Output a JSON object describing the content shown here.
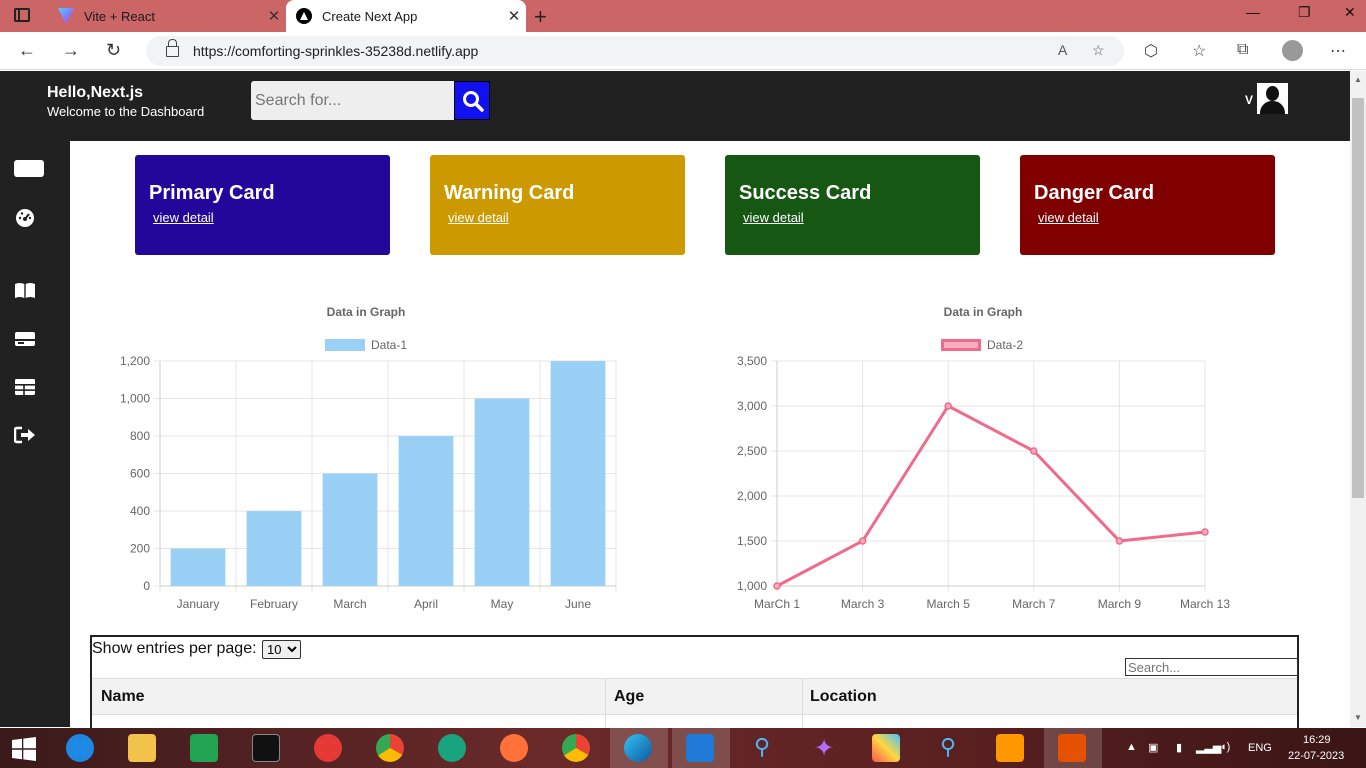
{
  "browser": {
    "tabs": [
      {
        "title": "Vite + React",
        "active": false
      },
      {
        "title": "Create Next App",
        "active": true
      }
    ],
    "url": "https://comforting-sprinkles-35238d.netlify.app"
  },
  "header": {
    "title": "Hello,Next.js",
    "subtitle": "Welcome to the Dashboard",
    "search_placeholder": "Search for...",
    "user_initial": "V"
  },
  "sidebar": {
    "icons": [
      "id-card-icon",
      "dashboard-gauge-icon",
      "book-icon",
      "card-icon",
      "table-icon",
      "logout-icon"
    ]
  },
  "cards": [
    {
      "title": "Primary Card",
      "link": "view detail",
      "color": "#22089a"
    },
    {
      "title": "Warning Card",
      "link": "view detail",
      "color": "#cc9900"
    },
    {
      "title": "Success Card",
      "link": "view detail",
      "color": "#165713"
    },
    {
      "title": "Danger Card",
      "link": "view detail",
      "color": "#800000"
    }
  ],
  "chart_data": [
    {
      "type": "bar",
      "title": "Data in Graph",
      "legend": "Data-1",
      "categories": [
        "January",
        "February",
        "March",
        "April",
        "May",
        "June"
      ],
      "values": [
        200,
        400,
        600,
        800,
        1000,
        1200
      ],
      "ylim": [
        0,
        1200
      ],
      "yticks": [
        "0",
        "200",
        "400",
        "600",
        "800",
        "1,000",
        "1,200"
      ],
      "color": "#9ad0f5"
    },
    {
      "type": "line",
      "title": "Data in Graph",
      "legend": "Data-2",
      "categories": [
        "MarCh 1",
        "March 3",
        "March 5",
        "March 7",
        "March 9",
        "March 13"
      ],
      "values": [
        1000,
        1500,
        3000,
        2500,
        1500,
        1600
      ],
      "ylim": [
        1000,
        3500
      ],
      "yticks": [
        "1,000",
        "1,500",
        "2,000",
        "2,500",
        "3,000",
        "3,500"
      ],
      "color": "#f06a8a"
    }
  ],
  "table": {
    "show_label": "Show entries per page:",
    "entries_value": "10",
    "search_placeholder": "Search...",
    "columns": [
      "Name",
      "Age",
      "Location"
    ]
  },
  "taskbar": {
    "time": "16:29",
    "date": "22-07-2023",
    "lang": "ENG"
  }
}
